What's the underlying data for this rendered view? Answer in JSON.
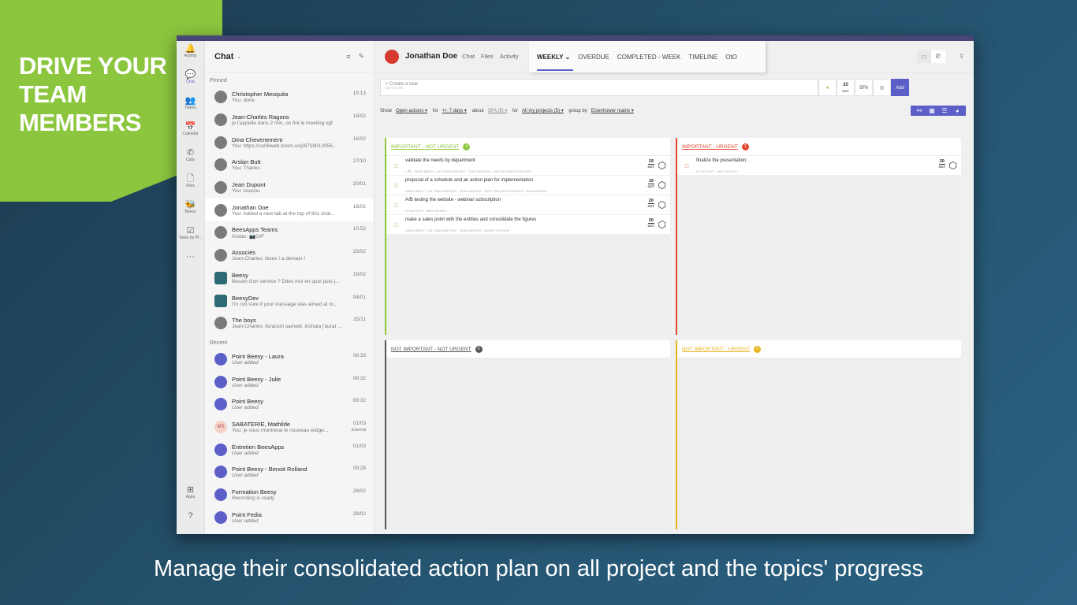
{
  "headline": [
    "DRIVE YOUR",
    "TEAM",
    "MEMBERS"
  ],
  "caption": "Manage their consolidated action plan on all project and the topics' progress",
  "rail": [
    {
      "label": "Activity",
      "icon": "bell-icon",
      "g": "🔔"
    },
    {
      "label": "Chat",
      "icon": "chat-icon",
      "g": "💬",
      "active": true
    },
    {
      "label": "Teams",
      "icon": "teams-icon",
      "g": "👥"
    },
    {
      "label": "Calendar",
      "icon": "calendar-icon",
      "g": "📅"
    },
    {
      "label": "Calls",
      "icon": "phone-icon",
      "g": "✆"
    },
    {
      "label": "Files",
      "icon": "file-icon",
      "g": "🗋"
    },
    {
      "label": "Beesy",
      "icon": "beesy-icon",
      "g": "🐝"
    },
    {
      "label": "Tasks by Pl...",
      "icon": "tasks-icon",
      "g": "☑"
    },
    {
      "label": "",
      "icon": "more-icon",
      "g": "···"
    }
  ],
  "rail_bottom": [
    {
      "label": "Apps",
      "icon": "apps-icon",
      "g": "⊞"
    },
    {
      "label": "",
      "icon": "help-icon",
      "g": "?"
    }
  ],
  "chat": {
    "title": "Chat",
    "pinned_label": "Pinned",
    "recent_label": "Recent",
    "pinned": [
      {
        "name": "Christopher Mesquita",
        "time": "15:13",
        "msg": "You: done"
      },
      {
        "name": "Jean-Charles Ragons",
        "time": "18/02",
        "msg": "je t'appelle dans 2 min, on fini le meeting vgf"
      },
      {
        "name": "Dina Chevenement",
        "time": "16/02",
        "msg": "You: https://us06web.zoom.us/j/8718012056..."
      },
      {
        "name": "Arslan Butt",
        "time": "27/10",
        "msg": "You: Thanks"
      },
      {
        "name": "Jean Dupont",
        "time": "20/01",
        "msg": "You: coucou"
      },
      {
        "name": "Jonathan Doe",
        "time": "16/02",
        "msg": "You: Added a new tab at the top of this chat...",
        "selected": true
      },
      {
        "name": "BeesApps Teams",
        "time": "10:52",
        "msg": "Arslan: 📷GIF"
      },
      {
        "name": "Associés",
        "time": "23/02",
        "msg": "Jean-Charles: bises ! a demain !"
      },
      {
        "name": "Beesy",
        "time": "18/02",
        "msg": "Besoin d'un service ? Dites moi en quoi puis-j...",
        "hex": true
      },
      {
        "name": "BeesyDev",
        "time": "04/01",
        "msg": "I'm not sure if your message was aimed at m...",
        "hex": true
      },
      {
        "name": "The boys",
        "time": "25/11",
        "msg": "Jean-Charles: livraison samedi, inchala j'aurai ..."
      }
    ],
    "recent": [
      {
        "name": "Point Beesy - Laura",
        "time": "08:33",
        "msg": "User added"
      },
      {
        "name": "Point Beesy - Julie",
        "time": "08:32",
        "msg": "User added"
      },
      {
        "name": "Point Beesy",
        "time": "08:32",
        "msg": "User added"
      },
      {
        "name": "SABATERIE, Mathilde",
        "time": "01/03",
        "msg": "You: je vous montrerai le nouveau widge...",
        "initials": "MS",
        "tag": "External"
      },
      {
        "name": "Entretien BeesApps",
        "time": "01/03",
        "msg": "User added"
      },
      {
        "name": "Point Beesy - Benoit Rolland",
        "time": "09:28",
        "msg": "User added"
      },
      {
        "name": "Formation Beesy",
        "time": "28/02",
        "msg": "Recording is ready"
      },
      {
        "name": "Point Fedia",
        "time": "28/02",
        "msg": "User added"
      }
    ]
  },
  "header": {
    "name": "Jonathan Doe",
    "tabs": [
      "Chat",
      "Files",
      "Activity"
    ],
    "app_tabs": [
      "WEEKLY ⌄",
      "OVERDUE",
      "COMPLETED - WEEK",
      "TIMELINE",
      "OtO"
    ]
  },
  "create": {
    "placeholder": "+ Create a task",
    "sub": "MES TÂCHES",
    "date_day": "20",
    "date_month": "OCT",
    "owner": "SFA",
    "add": "Add"
  },
  "filters": {
    "show": "Show",
    "show_v": "Open actions ▾",
    "for": "for",
    "for_v": "+/- 7 days ▾",
    "about": "about",
    "about_v": "SFA (5) ▾",
    "for2": "for",
    "for2_v": "All my projects (5) ▾",
    "group": "group by",
    "group_v": "Eisenhower matrix ▾"
  },
  "colors": {
    "accent": "#5b5fc7",
    "green": "#8cc63e",
    "red": "#e0492d",
    "gray": "#555555",
    "yellow": "#e8b21c"
  },
  "quadrants": [
    {
      "title": "IMPORTANT - NOT URGENT",
      "count": "4",
      "color": "#8cc63e",
      "tasks": [
        {
          "title": "validate the needs by department",
          "meta": "1 ⛓ - DEMO BEESY - 001-TEAM MEETING - TEAM MEETING - RECRUITMENT PLAN 2022",
          "day": "19",
          "month": "OCT"
        },
        {
          "title": "proposal of a schedule and an action plan for implementation",
          "meta": "DEMO BEESY - 031-TEAM MEETING - TEAM MEETING - BEST PRACTICES PROJECT MANAGEMENT",
          "day": "19",
          "month": "OCT"
        },
        {
          "title": "A/B testing the website - webinar subscription",
          "meta": "MY ACTIVITY - MES TÂCHES",
          "day": "20",
          "month": "OCT"
        },
        {
          "title": "make a sales point with the entities and consolidate the figures",
          "meta": "DEMO BEESY - 031-TEAM MEETING - TEAM MEETING - BUDGET REVIEW",
          "day": "20",
          "month": "OCT"
        }
      ]
    },
    {
      "title": "IMPORTANT - URGENT",
      "count": "1",
      "color": "#e0492d",
      "tasks": [
        {
          "title": "finalize the presentation",
          "meta": "MY ACTIVITY - MES TÂCHES",
          "day": "20",
          "month": "OCT"
        }
      ]
    },
    {
      "title": "NOT IMPORTANT - NOT URGENT",
      "count": "0",
      "color": "#555555",
      "tasks": []
    },
    {
      "title": "NOT IMPORTANT - URGENT",
      "count": "0",
      "color": "#e8b21c",
      "tasks": []
    }
  ]
}
